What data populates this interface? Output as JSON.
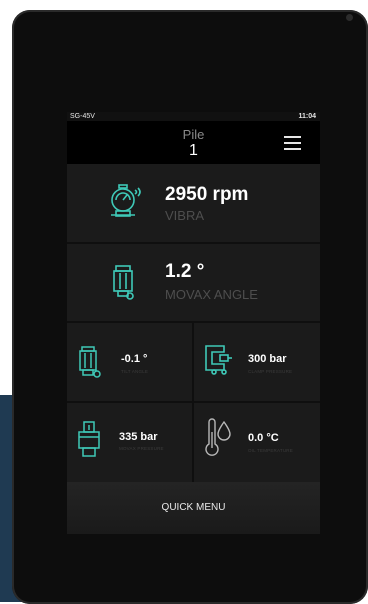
{
  "status": {
    "model": "SG-45V",
    "time": "11:04"
  },
  "header": {
    "pile_label": "Pile",
    "pile_number": "1"
  },
  "vibra": {
    "value": "2950 rpm",
    "label": "VIBRA"
  },
  "movax_angle": {
    "value": "1.2 °",
    "label": "MOVAX ANGLE"
  },
  "tilt_angle": {
    "value": "-0.1 °",
    "label": "TILT ANGLE"
  },
  "clamp_pressure": {
    "value": "300 bar",
    "label": "CLAMP PRESSURE"
  },
  "movax_pressure": {
    "value": "335 bar",
    "label": "MOVAX PRESSURE"
  },
  "oil_temperature": {
    "value": "0.0 °C",
    "label": "OIL TEMPERATURE"
  },
  "quick_menu": {
    "label": "QUICK MENU"
  },
  "icons": {
    "menu": "hamburger-menu-icon",
    "vibra": "vibro-hammer-icon",
    "movax_angle": "movax-device-icon",
    "tilt": "tilt-device-icon",
    "clamp": "clamp-icon",
    "movax_pressure": "pressure-device-icon",
    "oil": "thermometer-drop-icon"
  },
  "colors": {
    "accent": "#3fc9b8",
    "background": "#1b1b1b",
    "header": "#000000"
  }
}
